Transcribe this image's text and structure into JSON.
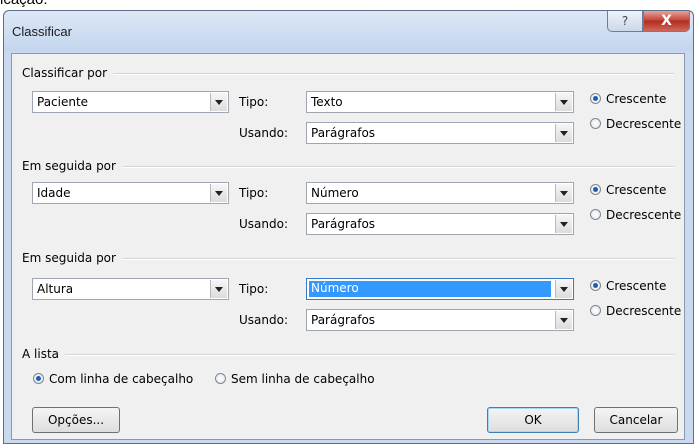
{
  "page_caption": "icação:",
  "window": {
    "title": "Classificar",
    "help_label": "?",
    "close_label": "X"
  },
  "sort_keys": [
    {
      "section_title": "Classificar por",
      "field": "Paciente",
      "type_label": "Tipo:",
      "type_value": "Texto",
      "using_label": "Usando:",
      "using_value": "Parágrafos",
      "asc_label": "Crescente",
      "desc_label": "Decrescente",
      "order": "asc"
    },
    {
      "section_title": "Em seguida por",
      "field": "Idade",
      "type_label": "Tipo:",
      "type_value": "Número",
      "using_label": "Usando:",
      "using_value": "Parágrafos",
      "asc_label": "Crescente",
      "desc_label": "Decrescente",
      "order": "asc"
    },
    {
      "section_title": "Em seguida por",
      "field": "Altura",
      "type_label": "Tipo:",
      "type_value": "Número",
      "using_label": "Usando:",
      "using_value": "Parágrafos",
      "asc_label": "Crescente",
      "desc_label": "Decrescente",
      "order": "asc",
      "type_selected": true
    }
  ],
  "list": {
    "section_title": "A lista",
    "with_header_label": "Com linha de cabeçalho",
    "without_header_label": "Sem linha de cabeçalho",
    "selected": "with_header"
  },
  "buttons": {
    "options": "Opções...",
    "ok": "OK",
    "cancel": "Cancelar"
  },
  "colors": {
    "selection": "#3399ff",
    "titlebar": "#c9daf0",
    "client": "#f0f0f0"
  }
}
